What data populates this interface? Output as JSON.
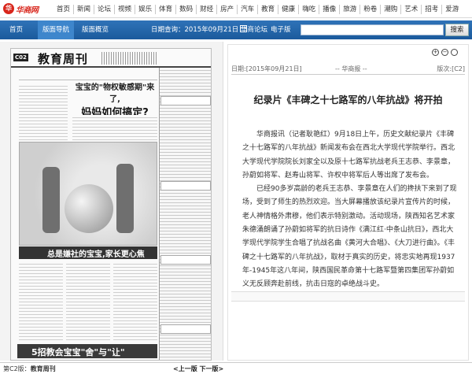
{
  "site": {
    "logo_text": "华商网",
    "nav": [
      "首页",
      "新闻",
      "论坛",
      "视频",
      "娱乐",
      "体育",
      "数码",
      "财经",
      "房产",
      "汽车",
      "教育",
      "健康",
      "嗨吃",
      "播像",
      "旅游",
      "粉卷",
      "潮购",
      "艺术",
      "招考",
      "爱游"
    ]
  },
  "toolbar": {
    "home": "首页",
    "page_nav": "版面导航",
    "page_overview": "版面概览",
    "date_label": "日期查询：",
    "date_value": "2015年09月21日",
    "forum": "华商论坛",
    "e_paper": "电子版",
    "search_placeholder": "",
    "search_button": "搜索"
  },
  "paper": {
    "section_no": "C02",
    "section_title": "教育周刊",
    "headline_line1": "宝宝的\"物权敏感期\"来了,",
    "headline_line2": "妈妈如何搞定?",
    "band_text": "总是嫌社的宝宝,家长更心焦",
    "band2_text": "5招教会宝宝\"舍\"与\"让\""
  },
  "article": {
    "meta_date": "日期:[2015年09月21日]",
    "meta_source": "-- 华商报 --",
    "meta_page": "版次:[C2]",
    "title": "纪录片《丰碑之十七路军的八年抗战》将开拍",
    "paragraphs": [
      "华商报讯（记者耿艳红）9月18日上午，历史文献纪录片《丰碑之十七路军的八年抗战》新闻发布会在西北大学现代学院举行。西北大学现代学院院长刘家全以及原十七路军抗战老兵王志恭、李景章，孙蔚如将军、赵寿山将军、许权中将军后人等出席了发布会。",
      "已经90多岁高龄的老兵王志恭、李景章在人们的搀扶下来到了现场，受到了师生的热烈欢迎。当大屏幕播放该纪录片宣传片的时候，老人神情格外肃穆，他们表示特别激动。活动现场，陕西知名艺术家朱德涌朗诵了孙蔚如将军的抗日诗作《满江红·中条山抗日》，西北大学现代学院学生合唱了抗战名曲《黄河大合唱》、《大刀进行曲》。《丰碑之十七路军的八年抗战》，取材于真实的历史，将忠实地再现1937年-1945年这八年间，陕西国民革命第十七路军暨第四集团军孙蔚如义无反顾奔赴前线，抗击日寇的卓绝战斗史。"
    ]
  },
  "footer": {
    "edition_prefix": "第C2版：",
    "edition_name": "教育周刊",
    "pager": "<上一版  下一版>"
  }
}
